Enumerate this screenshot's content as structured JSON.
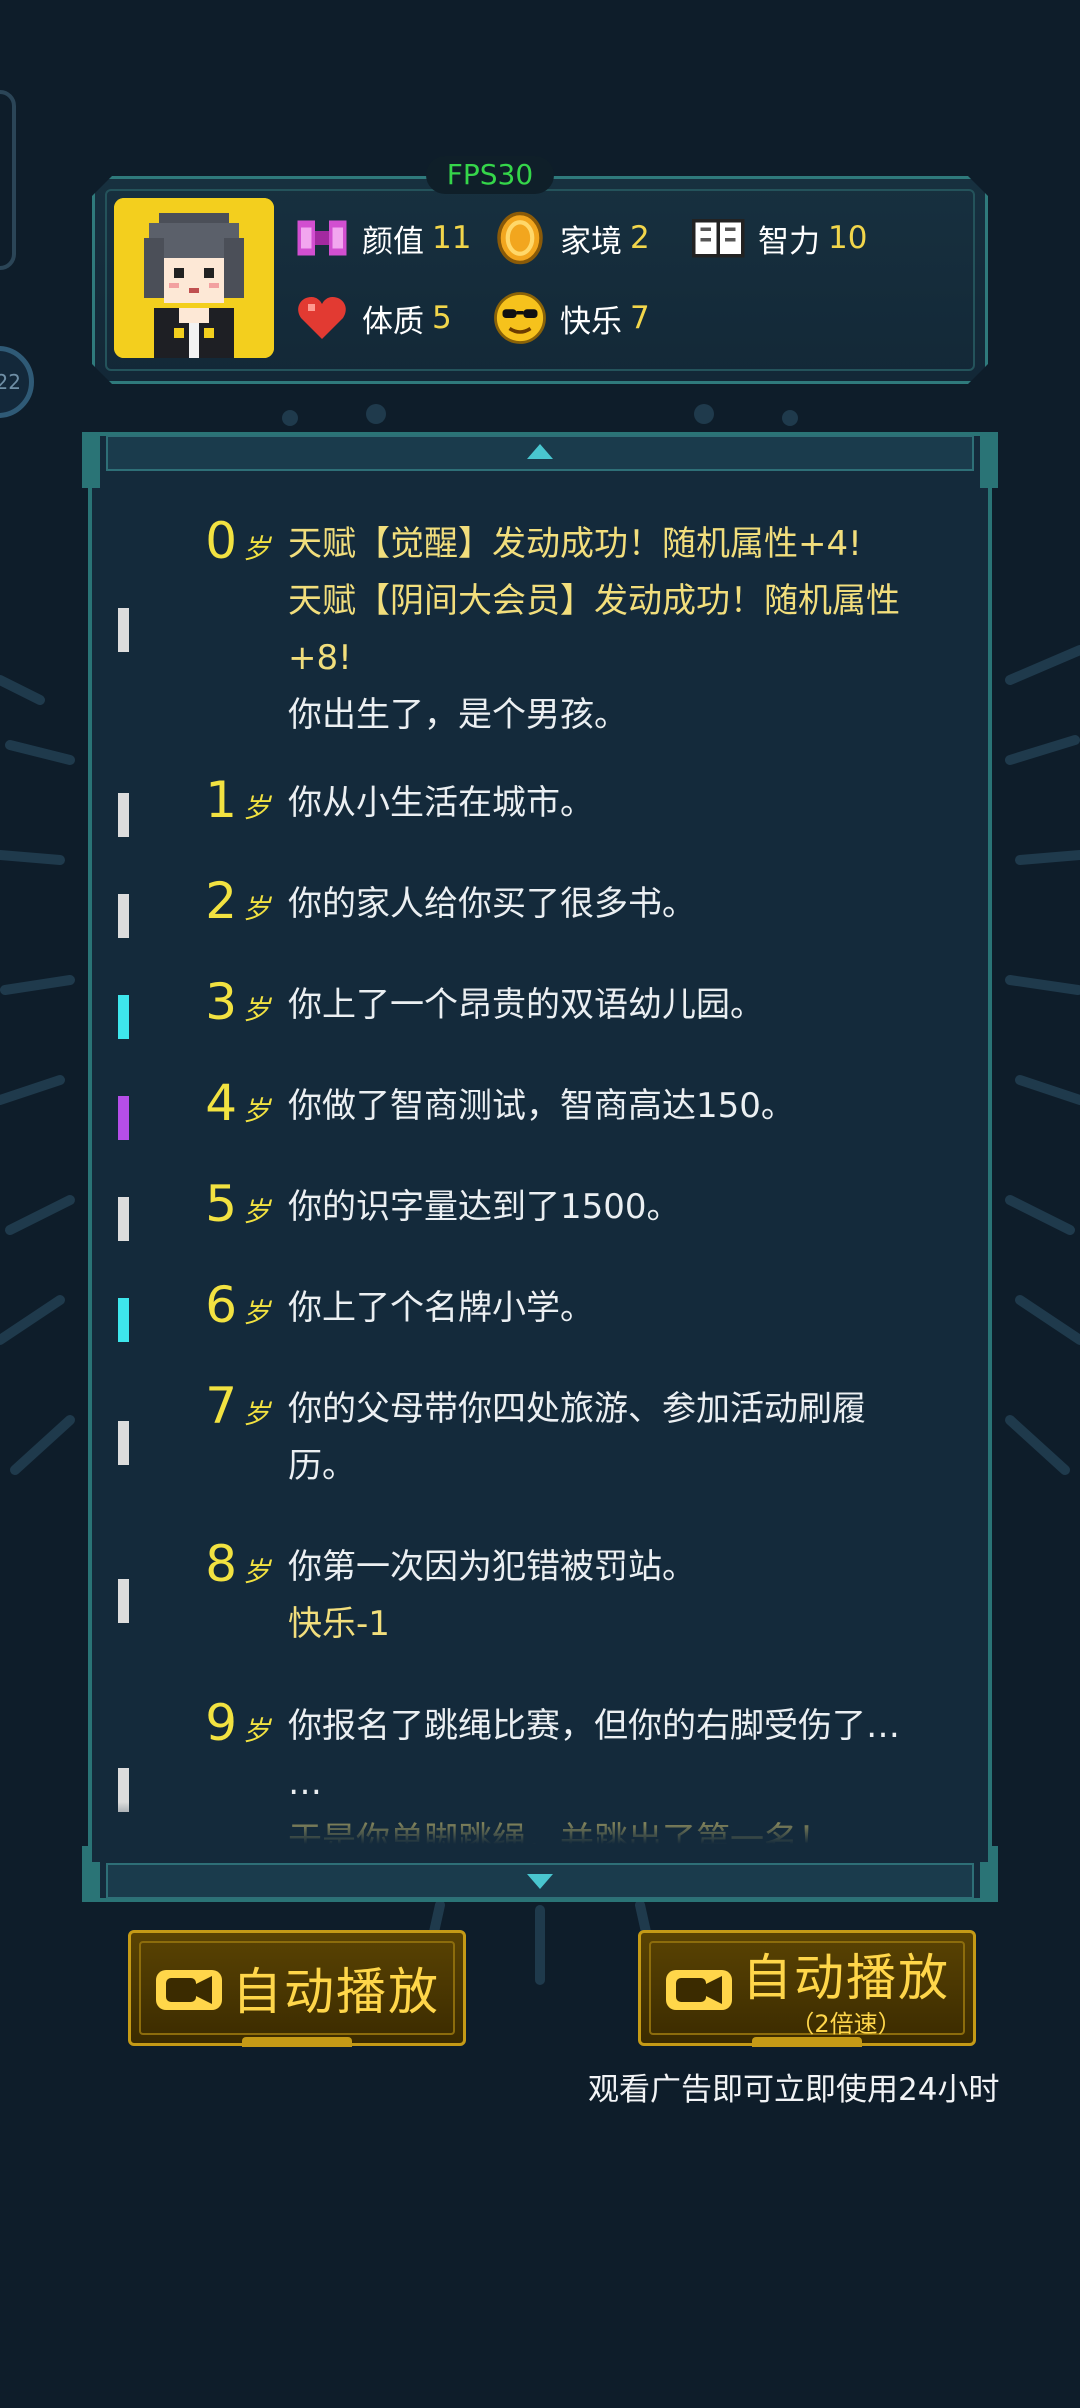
{
  "hud": {
    "fps": "FPS30",
    "stats": [
      {
        "label": "颜值",
        "value": "11",
        "icon": "bow-icon"
      },
      {
        "label": "家境",
        "value": "2",
        "icon": "coin-icon"
      },
      {
        "label": "智力",
        "value": "10",
        "icon": "book-icon"
      },
      {
        "label": "体质",
        "value": "5",
        "icon": "heart-icon"
      },
      {
        "label": "快乐",
        "value": "7",
        "icon": "sunglasses-face-icon"
      }
    ]
  },
  "log": {
    "age_suffix": "岁",
    "entries": [
      {
        "age": "0",
        "marker": "#dcdcdc",
        "lines": [
          {
            "text": "天赋【觉醒】发动成功！随机属性+4!",
            "tone": "yellow"
          },
          {
            "text": "天赋【阴间大会员】发动成功！随机属性",
            "tone": "yellow"
          },
          {
            "text": "+8!",
            "tone": "yellow"
          },
          {
            "text": "你出生了，是个男孩。",
            "tone": "white"
          }
        ]
      },
      {
        "age": "1",
        "marker": "#dcdcdc",
        "lines": [
          {
            "text": "你从小生活在城市。",
            "tone": "white"
          }
        ]
      },
      {
        "age": "2",
        "marker": "#dcdcdc",
        "lines": [
          {
            "text": "你的家人给你买了很多书。",
            "tone": "white"
          }
        ]
      },
      {
        "age": "3",
        "marker": "#3ee6ec",
        "lines": [
          {
            "text": "你上了一个昂贵的双语幼儿园。",
            "tone": "white"
          }
        ]
      },
      {
        "age": "4",
        "marker": "#b64ee8",
        "lines": [
          {
            "text": "你做了智商测试，智商高达150。",
            "tone": "white"
          }
        ]
      },
      {
        "age": "5",
        "marker": "#dcdcdc",
        "lines": [
          {
            "text": "你的识字量达到了1500。",
            "tone": "white"
          }
        ]
      },
      {
        "age": "6",
        "marker": "#3ee6ec",
        "lines": [
          {
            "text": "你上了个名牌小学。",
            "tone": "white"
          }
        ]
      },
      {
        "age": "7",
        "marker": "#dcdcdc",
        "lines": [
          {
            "text": "你的父母带你四处旅游、参加活动刷履",
            "tone": "white"
          },
          {
            "text": "历。",
            "tone": "white"
          }
        ]
      },
      {
        "age": "8",
        "marker": "#dcdcdc",
        "lines": [
          {
            "text": "你第一次因为犯错被罚站。",
            "tone": "white"
          },
          {
            "text": "快乐-1",
            "tone": "yellow"
          }
        ]
      },
      {
        "age": "9",
        "marker": "#dcdcdc",
        "lines": [
          {
            "text": "你报名了跳绳比赛，但你的右脚受伤了…",
            "tone": "white"
          },
          {
            "text": "…",
            "tone": "white"
          },
          {
            "text": "于是你单脚跳绳，并跳出了第一名！",
            "tone": "yellow"
          }
        ]
      }
    ]
  },
  "buttons": {
    "autoplay_label": "自动播放",
    "autoplay_fast_label": "自动播放",
    "autoplay_fast_sub": "（2倍速）",
    "ad_note": "观看广告即可立即使用24小时"
  }
}
